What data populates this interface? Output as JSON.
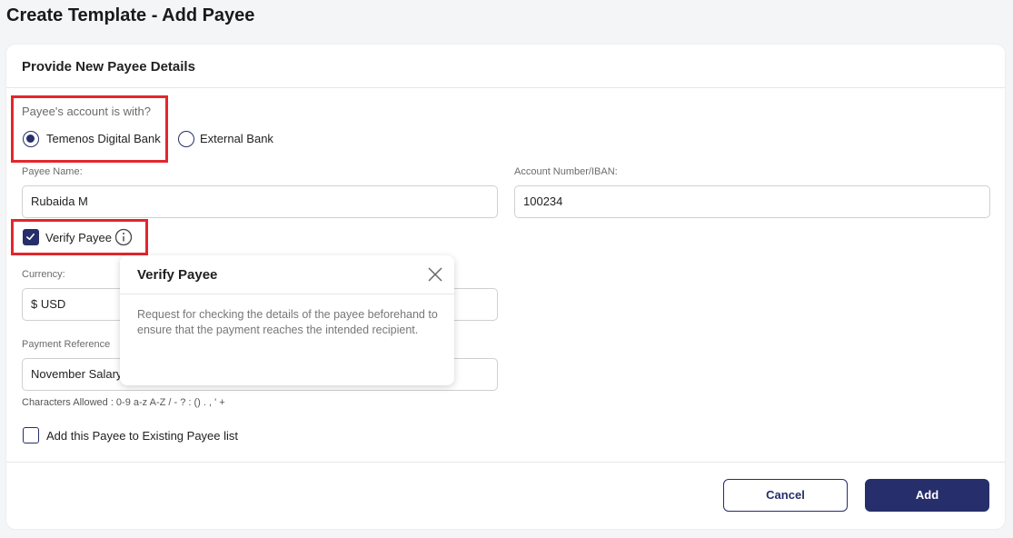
{
  "page": {
    "title": "Create Template - Add Payee"
  },
  "card": {
    "title": "Provide New Payee Details"
  },
  "bank_choice": {
    "question": "Payee's account is with?",
    "options": [
      {
        "label": "Temenos Digital Bank",
        "selected": true
      },
      {
        "label": "External Bank",
        "selected": false
      }
    ]
  },
  "fields": {
    "payee_name": {
      "label": "Payee Name:",
      "value": "Rubaida M"
    },
    "account_number": {
      "label": "Account Number/IBAN:",
      "value": "100234"
    },
    "currency": {
      "label": "Currency:",
      "value": "$ USD"
    },
    "payment_reference": {
      "label": "Payment Reference",
      "value": "November Salary",
      "hint": "Characters Allowed : 0-9 a-z A-Z / - ? : () . , ' +"
    }
  },
  "verify_payee": {
    "label": "Verify Payee",
    "checked": true
  },
  "add_to_list": {
    "label": "Add this Payee to Existing Payee list",
    "checked": false
  },
  "popover": {
    "title": "Verify Payee",
    "body": "Request for checking the details of the payee beforehand to ensure that the payment reaches the intended recipient."
  },
  "buttons": {
    "cancel": "Cancel",
    "add": "Add"
  },
  "colors": {
    "primary": "#262e6b",
    "highlight": "#e3262d"
  }
}
